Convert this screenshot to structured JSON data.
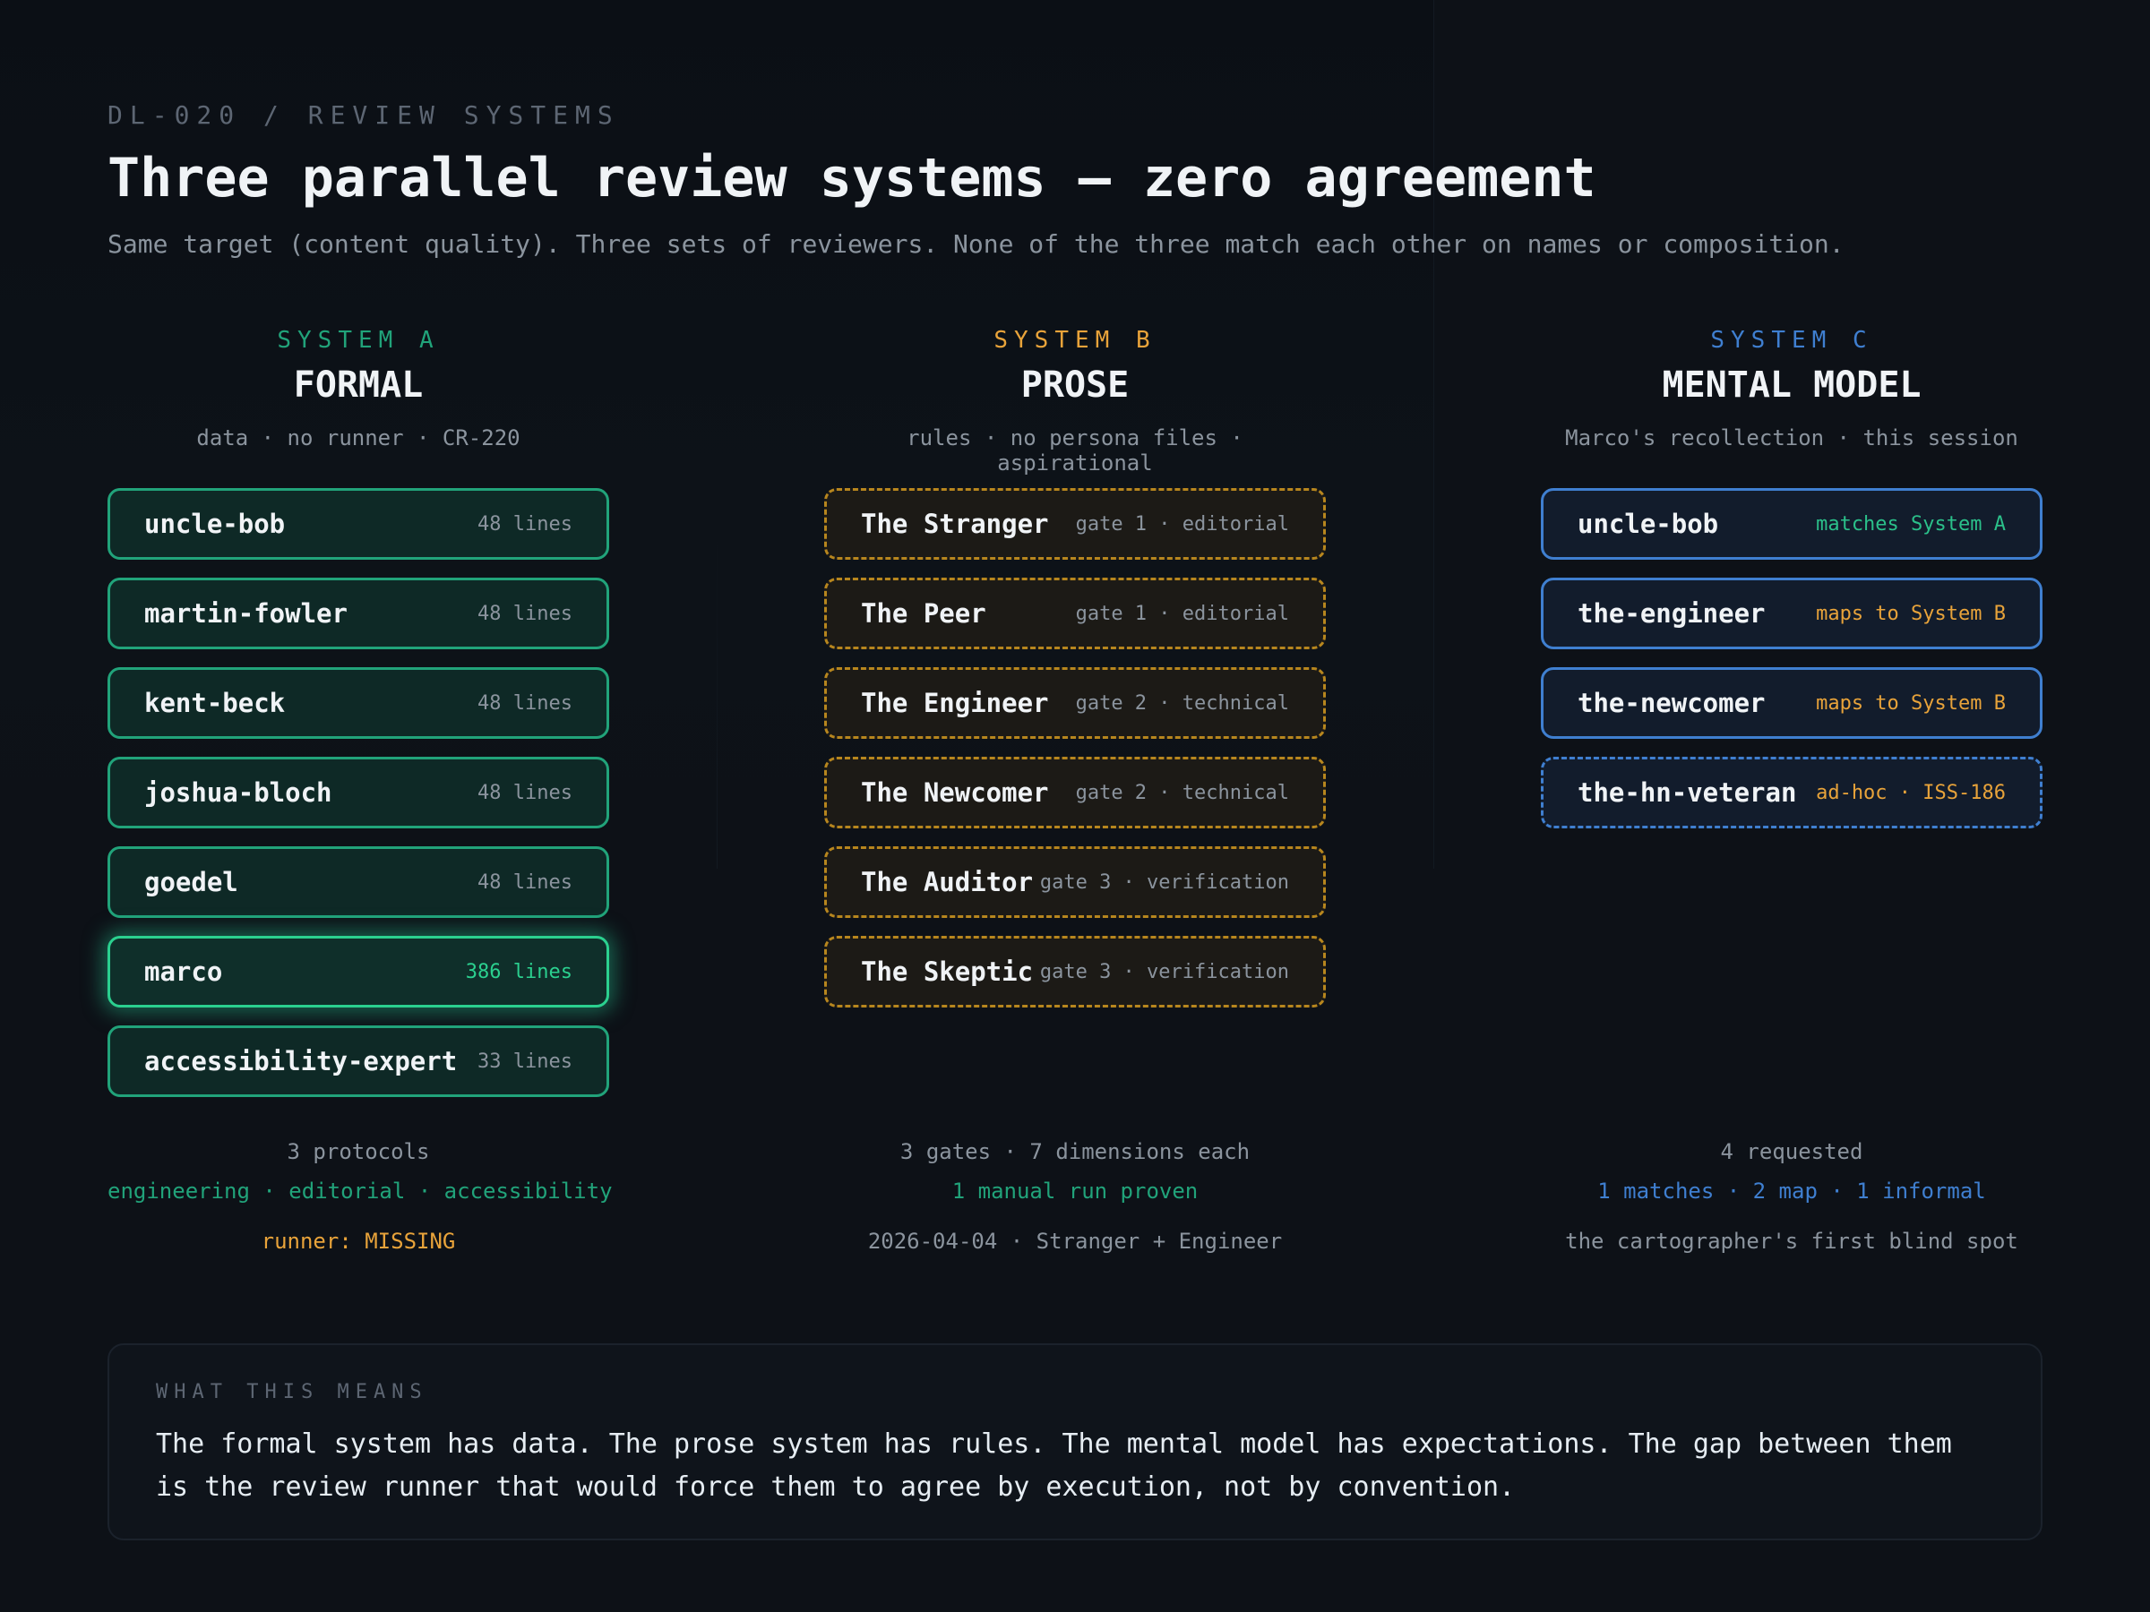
{
  "header": {
    "kicker": "DL-020 / REVIEW SYSTEMS",
    "title": "Three parallel review systems — zero agreement",
    "subtitle": "Same target (content quality). Three sets of reviewers. None of the three match each other on names or composition."
  },
  "colors": {
    "background": "#0d1117",
    "system_a": "#21a37a",
    "system_b": "#b7861e",
    "system_c": "#3f7fd0",
    "warning": "#e8a33a"
  },
  "systems": [
    {
      "label": "SYSTEM A",
      "name": "FORMAL",
      "desc": "data · no runner · CR-220",
      "cards": [
        {
          "name": "uncle-bob",
          "meta": "48 lines"
        },
        {
          "name": "martin-fowler",
          "meta": "48 lines"
        },
        {
          "name": "kent-beck",
          "meta": "48 lines"
        },
        {
          "name": "joshua-bloch",
          "meta": "48 lines"
        },
        {
          "name": "goedel",
          "meta": "48 lines"
        },
        {
          "name": "marco",
          "meta": "386 lines"
        },
        {
          "name": "accessibility-expert",
          "meta": "33 lines"
        }
      ],
      "footer": {
        "line1": "3 protocols",
        "line2": "engineering · editorial · accessibility",
        "line3": "runner: MISSING"
      }
    },
    {
      "label": "SYSTEM B",
      "name": "PROSE",
      "desc": "rules · no persona files · aspirational",
      "cards": [
        {
          "name": "The Stranger",
          "meta": "gate 1 · editorial"
        },
        {
          "name": "The Peer",
          "meta": "gate 1 · editorial"
        },
        {
          "name": "The Engineer",
          "meta": "gate 2 · technical"
        },
        {
          "name": "The Newcomer",
          "meta": "gate 2 · technical"
        },
        {
          "name": "The Auditor",
          "meta": "gate 3 · verification"
        },
        {
          "name": "The Skeptic",
          "meta": "gate 3 · verification"
        }
      ],
      "footer": {
        "line1": "3 gates · 7 dimensions each",
        "line2": "1 manual run proven",
        "line3": "2026-04-04 · Stranger + Engineer"
      }
    },
    {
      "label": "SYSTEM C",
      "name": "MENTAL MODEL",
      "desc": "Marco's recollection · this session",
      "cards": [
        {
          "name": "uncle-bob",
          "meta": "matches System A"
        },
        {
          "name": "the-engineer",
          "meta": "maps to System B"
        },
        {
          "name": "the-newcomer",
          "meta": "maps to System B"
        },
        {
          "name": "the-hn-veteran",
          "meta": "ad-hoc · ISS-186"
        }
      ],
      "footer": {
        "line1": "4 requested",
        "line2": "1 matches · 2 map · 1 informal",
        "line3": "the cartographer's first blind spot"
      }
    }
  ],
  "callout": {
    "label": "WHAT THIS MEANS",
    "text": "The formal system has data. The prose system has rules. The mental model has expectations. The gap between them is the review runner that would force them to agree by execution, not by convention."
  }
}
